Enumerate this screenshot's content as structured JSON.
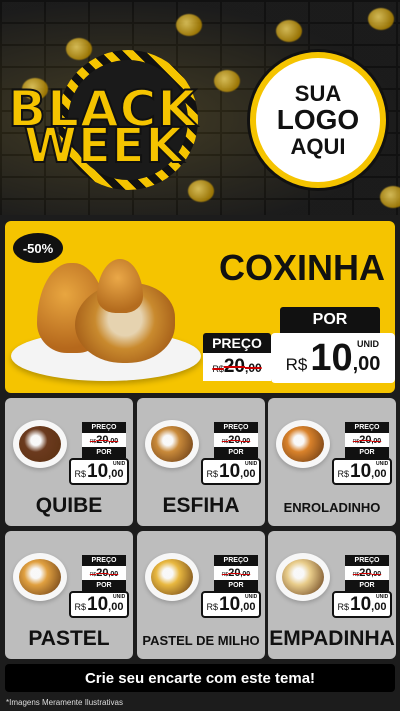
{
  "header": {
    "title_line1": "BLACK",
    "title_line2": "WEEK",
    "logo_line1": "SUA",
    "logo_line2": "LOGO",
    "logo_line3": "AQUI"
  },
  "featured": {
    "discount": "-50%",
    "name": "COXINHA",
    "por_label": "POR",
    "preco_label": "PREÇO",
    "old_currency": "R$",
    "old_int": "20",
    "old_dec": ",00",
    "new_currency": "R$",
    "new_int": "10",
    "new_dec": ",00",
    "unit": "UNID"
  },
  "labels": {
    "preco": "PREÇO",
    "por": "POR",
    "unid": "UNID",
    "currency": "R$"
  },
  "products": [
    {
      "name": "QUIBE",
      "old_int": "20",
      "old_dec": ",00",
      "new_int": "10",
      "new_dec": ",00",
      "food_color": "#6b3a1e"
    },
    {
      "name": "ESFIHA",
      "old_int": "20",
      "old_dec": ",00",
      "new_int": "10",
      "new_dec": ",00",
      "food_color": "#c98a3a"
    },
    {
      "name": "ENROLADINHO",
      "old_int": "20",
      "old_dec": ",00",
      "new_int": "10",
      "new_dec": ",00",
      "food_color": "#d9822b"
    },
    {
      "name": "PASTEL",
      "old_int": "20",
      "old_dec": ",00",
      "new_int": "10",
      "new_dec": ",00",
      "food_color": "#e0a040"
    },
    {
      "name": "PASTEL DE MILHO",
      "old_int": "20",
      "old_dec": ",00",
      "new_int": "10",
      "new_dec": ",00",
      "food_color": "#e8b840"
    },
    {
      "name": "EMPADINHA",
      "old_int": "20",
      "old_dec": ",00",
      "new_int": "10",
      "new_dec": ",00",
      "food_color": "#e8cc8a"
    }
  ],
  "cta": "Crie seu encarte com este tema!",
  "disclaimer": "*Imagens Meramente Ilustrativas",
  "colors": {
    "accent": "#f5c400",
    "card": "#bdbdbd",
    "background": "#1c1c1c"
  }
}
